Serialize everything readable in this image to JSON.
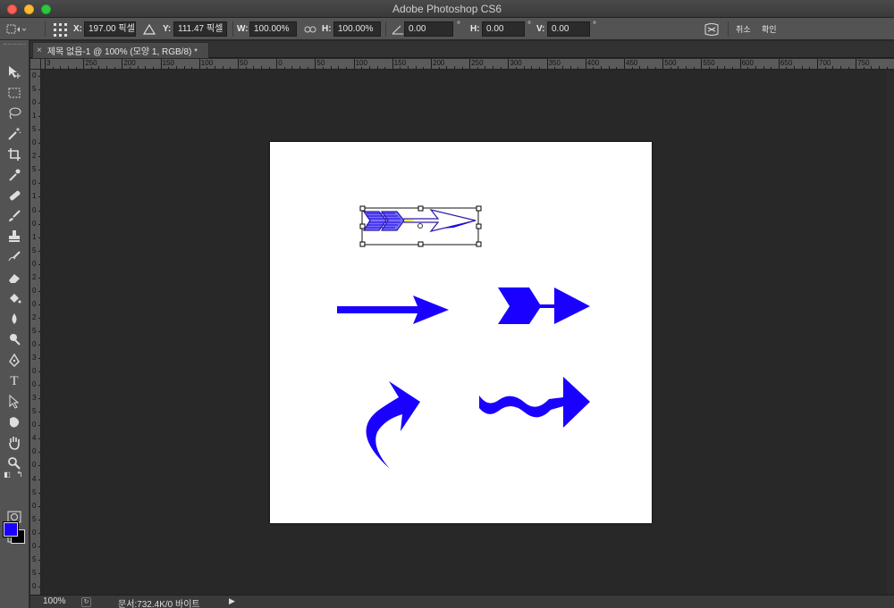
{
  "window": {
    "title": "Adobe Photoshop CS6"
  },
  "options_bar": {
    "x_label": "X:",
    "x_value": "197.00 픽셀",
    "delta_icon": "triangle-icon",
    "y_label": "Y:",
    "y_value": "111.47 픽셀",
    "w_label": "W:",
    "w_value": "100.00%",
    "h_label": "H:",
    "h_value": "100.00%",
    "angle_value": "0.00",
    "angle_unit": "°",
    "skew_h_label": "H:",
    "skew_h_value": "0.00",
    "skew_h_unit": "°",
    "skew_v_label": "V:",
    "skew_v_value": "0.00",
    "skew_v_unit": "°",
    "cancel_label": "취소",
    "commit_label": "확인"
  },
  "document": {
    "tab_label": "제목 없음-1 @ 100% (모양 1, RGB/8) *",
    "close_glyph": "×"
  },
  "rulers": {
    "horizontal": [
      "3",
      "250",
      "200",
      "150",
      "100",
      "50",
      "0",
      "50",
      "100",
      "150",
      "200",
      "250",
      "300",
      "350",
      "400",
      "450",
      "500",
      "550",
      "600",
      "650",
      "700",
      "750"
    ],
    "vertical": [
      "0",
      "5",
      "0",
      "1",
      "5",
      "0",
      "2",
      "5",
      "0",
      "1",
      "0",
      "0",
      "1",
      "5",
      "0",
      "2",
      "0",
      "0",
      "2",
      "5",
      "0",
      "3",
      "0",
      "0",
      "3",
      "5",
      "0",
      "4",
      "0",
      "0",
      "4",
      "5",
      "0",
      "5",
      "0",
      "0",
      "5",
      "5",
      "0"
    ]
  },
  "colors": {
    "foreground": "#1a00ff",
    "background": "#000000",
    "arrow_fill": "#1a00ff"
  },
  "status": {
    "zoom": "100%",
    "doc_info": "문서:732.4K/0 바이트"
  }
}
